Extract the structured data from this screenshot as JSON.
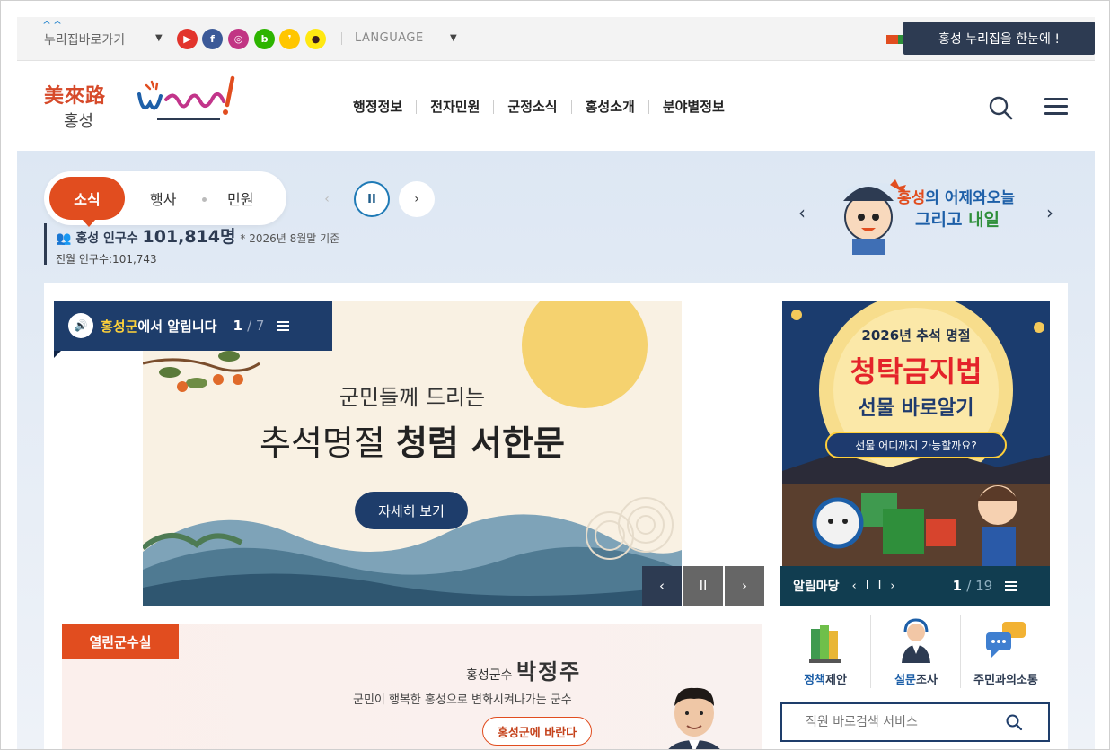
{
  "topbar": {
    "nuri_link": "누리집바로가기",
    "language": "LANGUAGE",
    "nuri_onescreen": "홍성 누리집을 한눈에 !",
    "sns": [
      {
        "name": "youtube-icon",
        "color": "#e2342c"
      },
      {
        "name": "facebook-icon",
        "color": "#3b5998"
      },
      {
        "name": "instagram-icon",
        "color": "#c13584"
      },
      {
        "name": "blog-icon",
        "color": "#2db400"
      },
      {
        "name": "kakaostory-icon",
        "color": "#ffc600"
      },
      {
        "name": "kakaotalk-icon",
        "color": "#ffe812"
      }
    ]
  },
  "header": {
    "logo_line1": "美來路",
    "logo_line2": "홍성",
    "nav": [
      "행정정보",
      "전자민원",
      "군정소식",
      "홍성소개",
      "분야별정보"
    ]
  },
  "hero": {
    "tabs": [
      "소식",
      "행사",
      "민원"
    ],
    "population_label": "홍성 인구수",
    "population_value": "101,814명",
    "population_note": "* 2026년 8월말 기준",
    "population_prev": "전월 인구수:101,743",
    "promo_t1_a": "홍성",
    "promo_t1_b": "의 어제와오늘",
    "promo_t2_a": "그리고 ",
    "promo_t2_b": "내일"
  },
  "notice": {
    "title_highlight": "홍성군",
    "title_rest": "에서 알립니다",
    "current": "1",
    "total": "/ 7"
  },
  "slide": {
    "sub": "군민들께 드리는",
    "main_light": "추석명절 ",
    "main_bold": "청렴 서한문",
    "button": "자세히 보기"
  },
  "side_banner": {
    "year": "2026년 추석 명절",
    "big": "청탁금지법",
    "mid": "선물 바로알기",
    "pill": "선물 어디까지 가능할까요?",
    "bar_label": "알림마당",
    "current": "1",
    "total": "/ 19"
  },
  "mayor": {
    "tag": "열린군수실",
    "title": "홍성군수 ",
    "name": "박정주",
    "desc": "군민이 행복한 홍성으로 변화시켜나가는 군수",
    "button": "홍성군에 바란다"
  },
  "quick": [
    {
      "highlight": "정책",
      "rest": "제안"
    },
    {
      "highlight": "설문",
      "rest": "조사"
    },
    {
      "highlight": "",
      "rest": "주민과의소통"
    }
  ],
  "staff_search": {
    "placeholder": "직원 바로검색 서비스"
  },
  "colors": {
    "brand_orange": "#e14d1f",
    "brand_navy": "#1e3d6b",
    "teal": "#113d50"
  }
}
